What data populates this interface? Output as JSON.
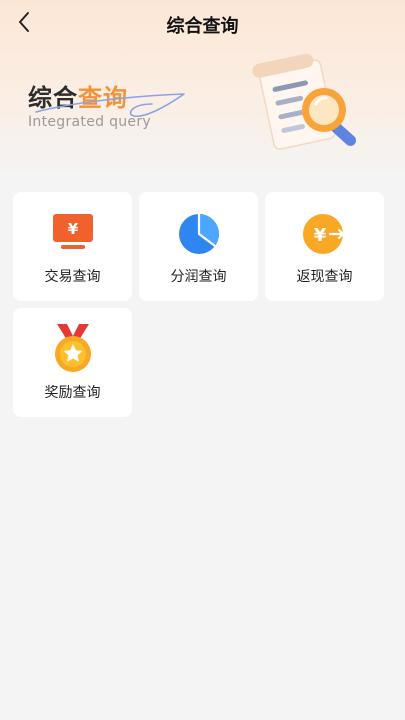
{
  "header": {
    "title": "综合查询",
    "back_icon": "chevron-left-icon"
  },
  "banner": {
    "title_dark": "综合",
    "title_accent": "查询",
    "subtitle": "Integrated query",
    "accent_color": "#f2933a"
  },
  "menu": [
    {
      "label": "交易查询",
      "icon": "monitor-yen-icon"
    },
    {
      "label": "分润查询",
      "icon": "pie-chart-icon"
    },
    {
      "label": "返现查询",
      "icon": "yen-arrow-icon"
    },
    {
      "label": "奖励查询",
      "icon": "medal-icon"
    }
  ]
}
